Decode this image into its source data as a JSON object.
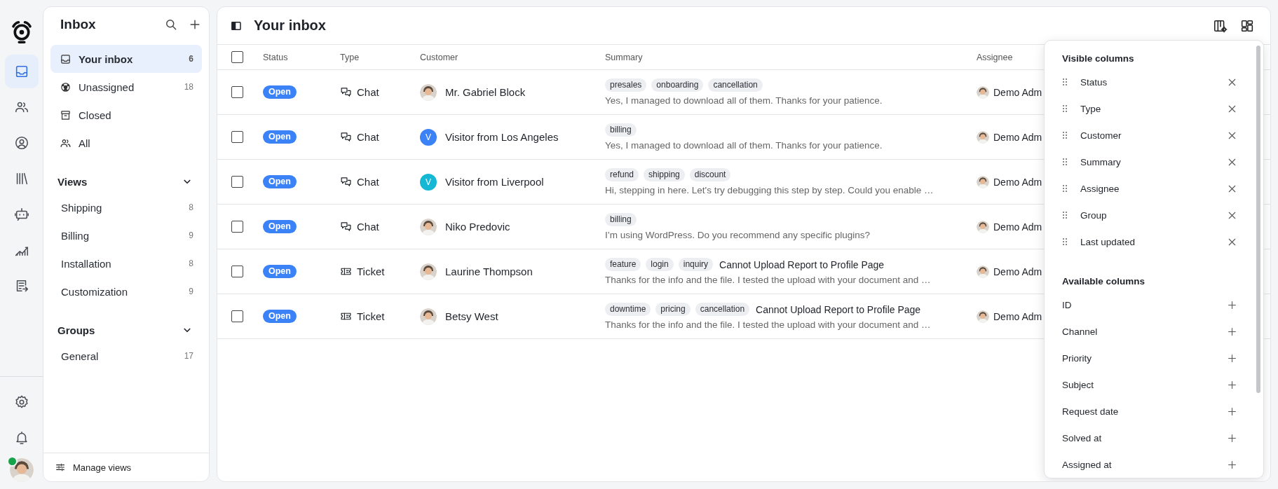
{
  "rail": {
    "items": [
      {
        "kind": "inbox",
        "selected": true
      },
      {
        "kind": "people",
        "selected": false
      },
      {
        "kind": "user",
        "selected": false
      },
      {
        "kind": "library",
        "selected": false
      },
      {
        "kind": "bot",
        "selected": false
      },
      {
        "kind": "chart",
        "selected": false
      },
      {
        "kind": "compose",
        "selected": false
      }
    ],
    "bottom": [
      {
        "kind": "gear"
      },
      {
        "kind": "bell"
      }
    ],
    "profile": {
      "online": true
    }
  },
  "sidebar": {
    "title": "Inbox",
    "items": [
      {
        "kind": "inbox",
        "label": "Your inbox",
        "count": "6",
        "selected": true
      },
      {
        "kind": "unassigned",
        "label": "Unassigned",
        "count": "18",
        "selected": false
      },
      {
        "kind": "archive",
        "label": "Closed",
        "selected": false
      },
      {
        "kind": "people",
        "label": "All",
        "selected": false
      }
    ],
    "sections": [
      {
        "title": "Views",
        "expanded": true,
        "items": [
          {
            "label": "Shipping",
            "count": "8",
            "selected": false
          },
          {
            "label": "Billing",
            "count": "9",
            "selected": false
          },
          {
            "label": "Installation",
            "count": "8",
            "selected": false
          },
          {
            "label": "Customization",
            "count": "9",
            "selected": false
          }
        ]
      },
      {
        "title": "Groups",
        "expanded": true,
        "items": [
          {
            "label": "General",
            "count": "17",
            "selected": false
          }
        ]
      }
    ],
    "footer": "Manage views"
  },
  "main": {
    "title": "Your inbox",
    "all_checked": false,
    "columns": [
      "Status",
      "Type",
      "Customer",
      "Summary",
      "Assignee"
    ],
    "rows": [
      {
        "checked": false,
        "status": "Open",
        "type": "Chat",
        "kind": "chat",
        "customer": {
          "name": "Mr. Gabriel Block",
          "kind": "photo"
        },
        "tags": [
          "presales",
          "onboarding",
          "cancellation"
        ],
        "message": "Yes, I managed to download all of them. Thanks for your patience.",
        "assignee": "Demo Adm"
      },
      {
        "checked": false,
        "status": "Open",
        "type": "Chat",
        "kind": "chat",
        "customer": {
          "name": "Visitor from Los Angeles",
          "kind": "initial",
          "initial": "V",
          "color": "#3b82f6"
        },
        "tags": [
          "billing"
        ],
        "message": "Yes, I managed to download all of them. Thanks for your patience.",
        "assignee": "Demo Adm"
      },
      {
        "checked": false,
        "status": "Open",
        "type": "Chat",
        "kind": "chat",
        "customer": {
          "name": "Visitor from Liverpool",
          "kind": "initial",
          "initial": "V",
          "color": "#14b8d4"
        },
        "tags": [
          "refund",
          "shipping",
          "discount"
        ],
        "message": "Hi, stepping in here. Let's try debugging this step by step. Could you enable …",
        "assignee": "Demo Adm"
      },
      {
        "checked": false,
        "status": "Open",
        "type": "Chat",
        "kind": "chat",
        "customer": {
          "name": "Niko Predovic",
          "kind": "photo"
        },
        "tags": [
          "billing"
        ],
        "message": "I’m using WordPress. Do you recommend any specific plugins?",
        "assignee": "Demo Adm"
      },
      {
        "checked": false,
        "status": "Open",
        "type": "Ticket",
        "kind": "ticket",
        "customer": {
          "name": "Laurine Thompson",
          "kind": "photo"
        },
        "tags": [
          "feature",
          "login",
          "inquiry"
        ],
        "subject": "Cannot Upload Report to Profile Page",
        "message": "Thanks for the info and the file. I tested the upload with your document and …",
        "assignee": "Demo Adm"
      },
      {
        "checked": false,
        "status": "Open",
        "type": "Ticket",
        "kind": "ticket",
        "customer": {
          "name": "Betsy West",
          "kind": "photo"
        },
        "tags": [
          "downtime",
          "pricing",
          "cancellation"
        ],
        "subject": "Cannot Upload Report to Profile Page",
        "message": "Thanks for the info and the file. I tested the upload with your document and …",
        "assignee": "Demo Adm"
      }
    ]
  },
  "column_picker": {
    "visible_title": "Visible columns",
    "visible": [
      "Status",
      "Type",
      "Customer",
      "Summary",
      "Assignee",
      "Group",
      "Last updated"
    ],
    "available_title": "Available columns",
    "available": [
      "ID",
      "Channel",
      "Priority",
      "Subject",
      "Request date",
      "Solved at",
      "Assigned at"
    ]
  }
}
